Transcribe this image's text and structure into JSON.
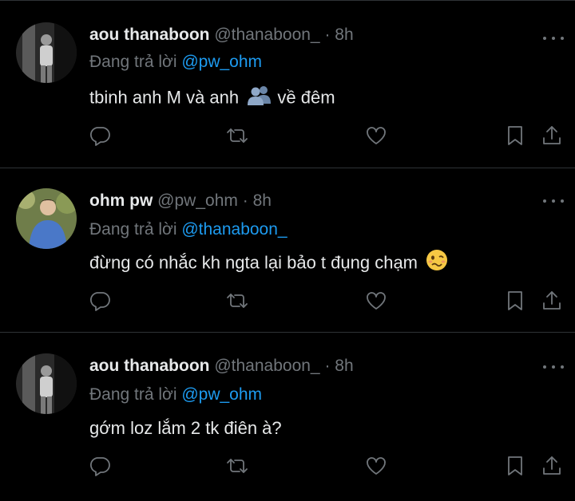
{
  "tweets": [
    {
      "name": "aou thanaboon",
      "handle": "@thanaboon_",
      "separator": "·",
      "time": "8h",
      "reply_prefix": "Đang trả lời",
      "reply_to": "@pw_ohm",
      "text": "tbinh anh M và anh",
      "text_after_emoji": "về đêm",
      "emoji": "busts-in-silhouette"
    },
    {
      "name": "ohm pw",
      "handle": "@pw_ohm",
      "separator": "·",
      "time": "8h",
      "reply_prefix": "Đang trả lời",
      "reply_to": "@thanaboon_",
      "text": "đừng có nhắc kh ngta lại bảo t đụng chạm",
      "emoji": "woozy-face"
    },
    {
      "name": "aou thanaboon",
      "handle": "@thanaboon_",
      "separator": "·",
      "time": "8h",
      "reply_prefix": "Đang trả lời",
      "reply_to": "@pw_ohm",
      "text": "gớm loz lắm 2 tk điên à?"
    }
  ],
  "colors": {
    "background": "#000000",
    "text": "#e7e9ea",
    "muted": "#71767b",
    "mention": "#1d9bf0",
    "separator": "#2f3336"
  }
}
